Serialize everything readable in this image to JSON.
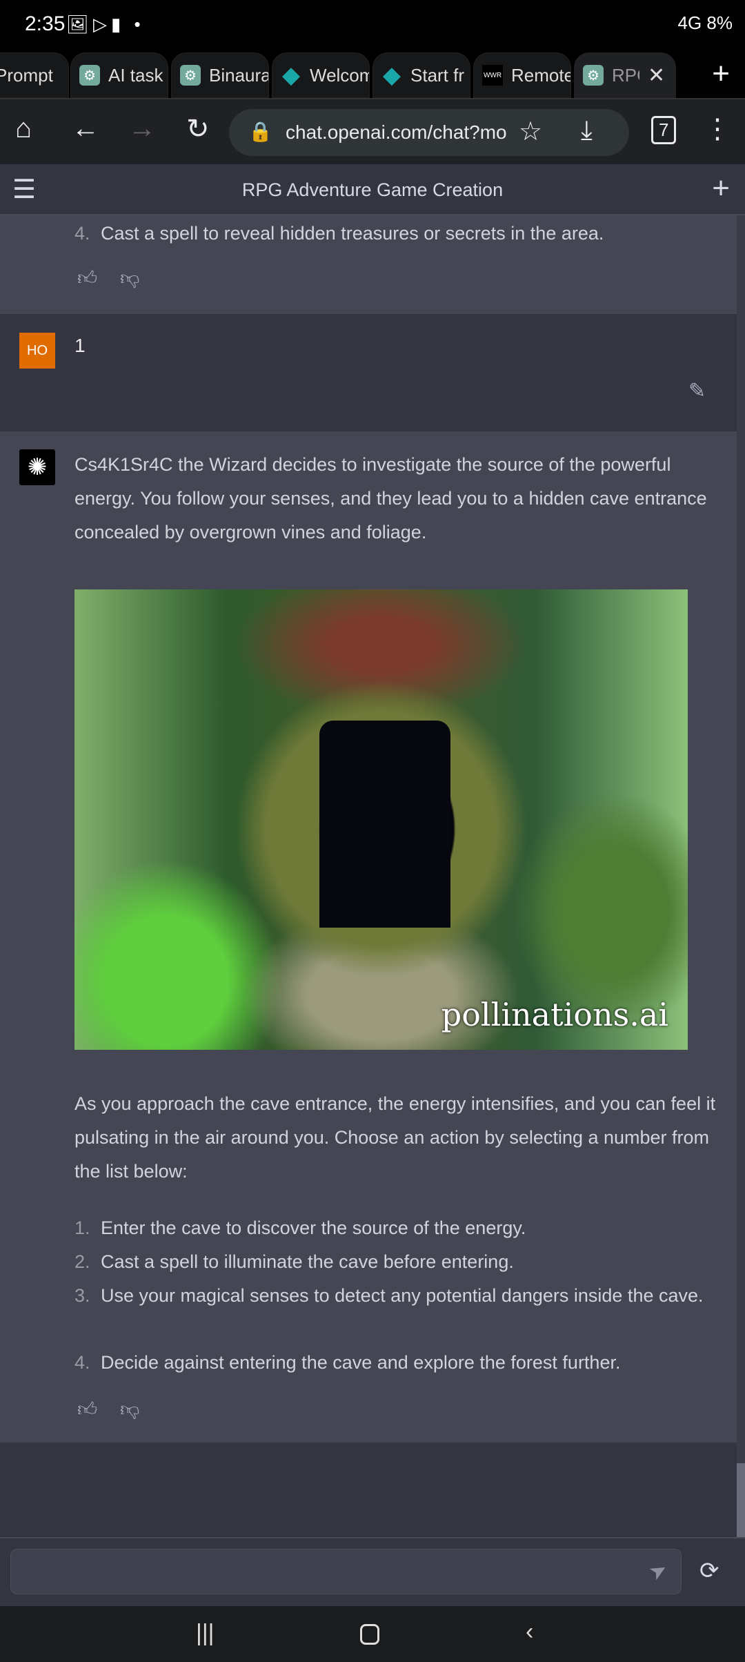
{
  "status": {
    "time": "2:35",
    "right": "4G 8%"
  },
  "tabs": [
    {
      "label": "Prompt",
      "icon": "none"
    },
    {
      "label": "AI task",
      "icon": "openai"
    },
    {
      "label": "Binaural",
      "icon": "openai"
    },
    {
      "label": "Welcome",
      "icon": "diamond"
    },
    {
      "label": "Start fr",
      "icon": "diamond"
    },
    {
      "label": "Remote",
      "icon": "wwr"
    },
    {
      "label": "RPG",
      "icon": "openai",
      "active": true
    }
  ],
  "toolbar": {
    "url": "chat.openai.com/chat?model",
    "tab_count": "7"
  },
  "chat": {
    "title": "RPG Adventure Game Creation"
  },
  "prev_item": {
    "num": "4.",
    "text": "Cast a spell to reveal hidden treasures or secrets in the area."
  },
  "user": {
    "avatar": "HO",
    "message": "1",
    "avatar_color": "#e06c00"
  },
  "assistant": {
    "intro": "Cs4K1Sr4C the Wizard decides to investigate the source of the powerful energy. You follow your senses, and they lead you to a hidden cave entrance concealed by overgrown vines and foliage.",
    "image_watermark": "pollinations.ai",
    "para": "As you approach the cave entrance, the energy intensifies, and you can feel it pulsating in the air around you. Choose an action by selecting a number from the list below:",
    "options": [
      {
        "num": "1.",
        "text": "Enter the cave to discover the source of the energy."
      },
      {
        "num": "2.",
        "text": "Cast a spell to illuminate the cave before entering."
      },
      {
        "num": "3.",
        "text": "Use your magical senses to detect any potential dangers inside the cave."
      },
      {
        "num": "4.",
        "text": "Decide against entering the cave and explore the forest further."
      }
    ]
  },
  "input": {
    "placeholder": ""
  }
}
